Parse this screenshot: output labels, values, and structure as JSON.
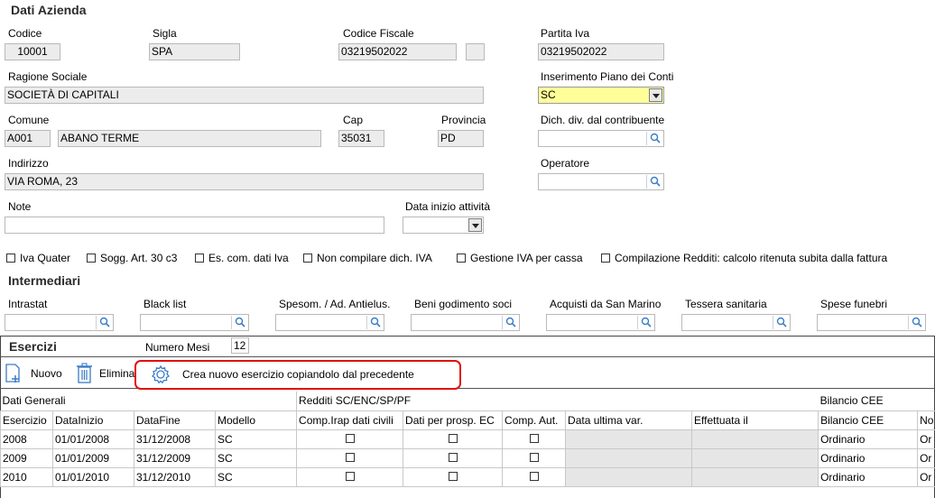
{
  "dati_azienda": {
    "title": "Dati Azienda",
    "codice": {
      "label": "Codice",
      "value": "10001"
    },
    "sigla": {
      "label": "Sigla",
      "value": "SPA"
    },
    "codice_fiscale": {
      "label": "Codice  Fiscale",
      "value": "03219502022"
    },
    "partita_iva": {
      "label": "Partita Iva",
      "value": "03219502022"
    },
    "ragione_sociale": {
      "label": "Ragione Sociale",
      "value": "SOCIETÀ DI CAPITALI"
    },
    "inserimento_piano": {
      "label": "Inserimento Piano dei Conti",
      "value": "SC"
    },
    "comune": {
      "label": "Comune",
      "code": "A001",
      "value": "ABANO TERME"
    },
    "cap": {
      "label": "Cap",
      "value": "35031"
    },
    "provincia": {
      "label": "Provincia",
      "value": "PD"
    },
    "dich_div": {
      "label": "Dich. div. dal contribuente",
      "value": ""
    },
    "indirizzo": {
      "label": "Indirizzo",
      "value": "VIA ROMA, 23"
    },
    "operatore": {
      "label": "Operatore",
      "value": ""
    },
    "note": {
      "label": "Note",
      "value": ""
    },
    "data_inizio": {
      "label": "Data inizio attività",
      "value": ""
    }
  },
  "checkboxes": [
    "Iva Quater",
    "Sogg. Art. 30 c3",
    "Es. com. dati Iva",
    "Non compilare dich. IVA",
    "Gestione IVA per cassa",
    "Compilazione Redditi: calcolo ritenuta subita dalla fattura"
  ],
  "intermediari": {
    "title": "Intermediari",
    "fields": [
      "Intrastat",
      "Black list",
      "Spesom. / Ad. Antielus.",
      "Beni godimento soci",
      "Acquisti da San Marino",
      "Tessera sanitaria",
      "Spese funebri"
    ]
  },
  "esercizi": {
    "title": "Esercizi",
    "numero_mesi_label": "Numero Mesi",
    "numero_mesi_value": "12",
    "toolbar": {
      "nuovo": "Nuovo",
      "elimina": "Elimina",
      "crea": "Crea nuovo esercizio copiandolo dal precedente"
    },
    "group_headers": {
      "dati_generali": "Dati Generali",
      "redditi": "Redditi SC/ENC/SP/PF",
      "bilancio": "Bilancio CEE"
    },
    "columns": [
      "Esercizio",
      "DataInizio",
      "DataFine",
      "Modello",
      "Comp.Irap dati civili",
      "Dati per prosp. EC",
      "Comp. Aut.",
      "Data ultima var.",
      "Effettuata il",
      "Bilancio CEE",
      "No"
    ],
    "rows": [
      {
        "esercizio": "2008",
        "inizio": "01/01/2008",
        "fine": "31/12/2008",
        "modello": "SC",
        "bilancio": "Ordinario",
        "extra": "Or"
      },
      {
        "esercizio": "2009",
        "inizio": "01/01/2009",
        "fine": "31/12/2009",
        "modello": "SC",
        "bilancio": "Ordinario",
        "extra": "Or"
      },
      {
        "esercizio": "2010",
        "inizio": "01/01/2010",
        "fine": "31/12/2010",
        "modello": "SC",
        "bilancio": "Ordinario",
        "extra": "Or"
      }
    ]
  },
  "colors": {
    "highlight_border": "#e01010",
    "yellow_field": "#ffff99",
    "icon_blue": "#3a7cc7"
  }
}
